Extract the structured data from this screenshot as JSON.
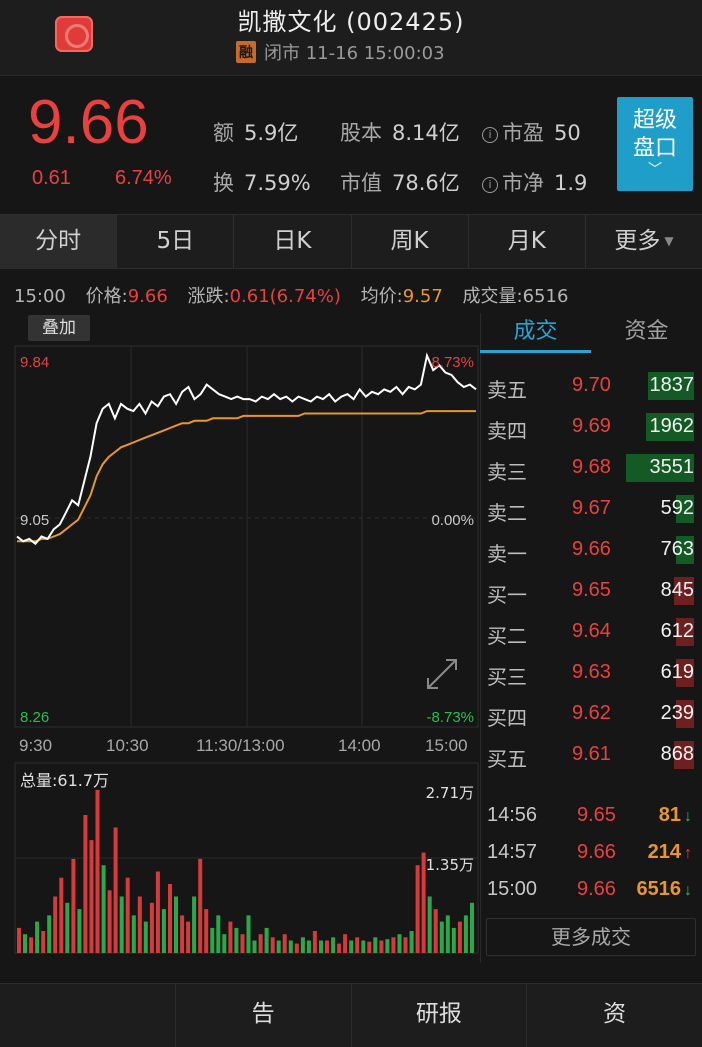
{
  "header": {
    "title": "凯撒文化 (002425)",
    "badge": "融",
    "status": "闭市 11-16 15:00:03"
  },
  "quote": {
    "price": "9.66",
    "change": "0.61",
    "change_pct": "6.74%",
    "stats": [
      {
        "label": "额",
        "value": "5.9亿"
      },
      {
        "label": "股本",
        "value": "8.14亿"
      },
      {
        "label": "市盈",
        "value": "50"
      },
      {
        "label": "换",
        "value": "7.59%"
      },
      {
        "label": "市值",
        "value": "78.6亿"
      },
      {
        "label": "市净",
        "value": "1.9"
      }
    ],
    "super_button": {
      "line1": "超级",
      "line2": "盘口",
      "chevron": "﹀"
    }
  },
  "tabs": [
    "分时",
    "5日",
    "日K",
    "周K",
    "月K",
    "更多"
  ],
  "infoline": {
    "time": "15:00",
    "price_label": "价格:",
    "price_value": "9.66",
    "change_label": "涨跌:",
    "change_value": "0.61(6.74%)",
    "avg_label": "均价:",
    "avg_value": "9.57",
    "volume_label": "成交量:",
    "volume_value": "6516"
  },
  "chart_overlay_button": "叠加",
  "chart_labels": {
    "y_top": "9.84",
    "y_mid": "9.05",
    "y_bottom": "8.26",
    "pct_top": "8.73%",
    "pct_mid": "0.00%",
    "pct_bottom": "-8.73%",
    "x_ticks": [
      "9:30",
      "10:30",
      "11:30/13:00",
      "14:00",
      "15:00"
    ],
    "volume_total": "总量:61.7万",
    "vol_top": "2.71万",
    "vol_mid": "1.35万"
  },
  "chart_data": {
    "type": "line",
    "title": "",
    "x_ticks": [
      "9:30",
      "10:30",
      "11:30/13:00",
      "14:00",
      "15:00"
    ],
    "ylim": [
      8.26,
      9.84
    ],
    "prev_close": 9.05,
    "series": [
      {
        "values": [
          9.05,
          9.03,
          9.04,
          9.02,
          9.05,
          9.04,
          9.08,
          9.1,
          9.15,
          9.2,
          9.18,
          9.28,
          9.38,
          9.52,
          9.58,
          9.6,
          9.54,
          9.6,
          9.58,
          9.57,
          9.6,
          9.56,
          9.61,
          9.59,
          9.63,
          9.64,
          9.6,
          9.65,
          9.67,
          9.62,
          9.64,
          9.68,
          9.66,
          9.64,
          9.63,
          9.62,
          9.63,
          9.62,
          9.62,
          9.61,
          9.63,
          9.62,
          9.64,
          9.62,
          9.63,
          9.61,
          9.63,
          9.62,
          9.61,
          9.63,
          9.62,
          9.64,
          9.61,
          9.63,
          9.64,
          9.62,
          9.66,
          9.63,
          9.65,
          9.64,
          9.66,
          9.65,
          9.67,
          9.64,
          9.67,
          9.66,
          9.68,
          9.8,
          9.74,
          9.76,
          9.73,
          9.72,
          9.69,
          9.67,
          9.68,
          9.66
        ]
      },
      {
        "values": [
          9.03,
          9.03,
          9.03,
          9.03,
          9.04,
          9.04,
          9.05,
          9.06,
          9.08,
          9.1,
          9.12,
          9.17,
          9.22,
          9.3,
          9.35,
          9.38,
          9.4,
          9.42,
          9.43,
          9.44,
          9.45,
          9.46,
          9.47,
          9.48,
          9.49,
          9.5,
          9.51,
          9.52,
          9.52,
          9.53,
          9.53,
          9.53,
          9.54,
          9.54,
          9.54,
          9.54,
          9.54,
          9.55,
          9.55,
          9.55,
          9.55,
          9.55,
          9.55,
          9.55,
          9.55,
          9.55,
          9.55,
          9.56,
          9.56,
          9.56,
          9.56,
          9.56,
          9.56,
          9.56,
          9.56,
          9.56,
          9.56,
          9.56,
          9.56,
          9.56,
          9.56,
          9.56,
          9.56,
          9.56,
          9.56,
          9.56,
          9.56,
          9.57,
          9.57,
          9.57,
          9.57,
          9.57,
          9.57,
          9.57,
          9.57,
          9.57
        ]
      }
    ],
    "volume": {
      "ylim": [
        0,
        27100
      ],
      "values": [
        4000,
        3000,
        2500,
        5000,
        3500,
        6000,
        9000,
        12000,
        8000,
        15000,
        7000,
        22000,
        18000,
        26000,
        14000,
        10000,
        20000,
        9000,
        12000,
        6000,
        9000,
        5000,
        8000,
        13000,
        7000,
        11000,
        9000,
        6000,
        5000,
        9000,
        15000,
        7000,
        4000,
        6000,
        3000,
        5000,
        4000,
        3000,
        6000,
        2000,
        3000,
        4000,
        2500,
        2000,
        3000,
        2000,
        1500,
        2500,
        2000,
        3500,
        2000,
        2000,
        2500,
        1500,
        3000,
        2000,
        2500,
        2000,
        1800,
        2500,
        2000,
        2200,
        2500,
        3000,
        2500,
        3500,
        14000,
        16000,
        9000,
        7000,
        5000,
        6000,
        4000,
        5000,
        6000,
        8000
      ],
      "up": [
        1,
        0,
        1,
        0,
        1,
        0,
        1,
        1,
        0,
        1,
        0,
        1,
        1,
        1,
        0,
        1,
        1,
        0,
        1,
        0,
        1,
        0,
        1,
        1,
        0,
        1,
        0,
        1,
        1,
        0,
        1,
        1,
        0,
        0,
        0,
        1,
        0,
        1,
        0,
        0,
        1,
        0,
        1,
        0,
        1,
        0,
        1,
        0,
        0,
        1,
        0,
        1,
        0,
        1,
        1,
        0,
        1,
        0,
        1,
        0,
        1,
        0,
        1,
        0,
        1,
        0,
        1,
        1,
        0,
        1,
        0,
        0,
        0,
        1,
        0,
        0
      ]
    }
  },
  "right_tabs": [
    "成交",
    "资金"
  ],
  "order_book": [
    {
      "label": "卖五",
      "price": "9.70",
      "vol": "1837",
      "side": "sell",
      "fill": 0.23
    },
    {
      "label": "卖四",
      "price": "9.69",
      "vol": "1962",
      "side": "sell",
      "fill": 0.24
    },
    {
      "label": "卖三",
      "price": "9.68",
      "vol": "3551",
      "side": "sell",
      "fill": 0.34
    },
    {
      "label": "卖二",
      "price": "9.67",
      "vol": "592",
      "side": "sell",
      "fill": 0.07
    },
    {
      "label": "卖一",
      "price": "9.66",
      "vol": "763",
      "side": "sell",
      "fill": 0.09
    },
    {
      "label": "买一",
      "price": "9.65",
      "vol": "845",
      "side": "buy",
      "fill": 0.1
    },
    {
      "label": "买二",
      "price": "9.64",
      "vol": "612",
      "side": "buy",
      "fill": 0.07
    },
    {
      "label": "买三",
      "price": "9.63",
      "vol": "619",
      "side": "buy",
      "fill": 0.07
    },
    {
      "label": "买四",
      "price": "9.62",
      "vol": "239",
      "side": "buy",
      "fill": 0.03
    },
    {
      "label": "买五",
      "price": "9.61",
      "vol": "868",
      "side": "buy",
      "fill": 0.1
    }
  ],
  "trades": [
    {
      "time": "14:56",
      "price": "9.65",
      "vol": "81",
      "dir": "↓",
      "dir_color": "#2cbe4e"
    },
    {
      "time": "14:57",
      "price": "9.66",
      "vol": "214",
      "dir": "↑",
      "dir_color": "#e8413f"
    },
    {
      "time": "15:00",
      "price": "9.66",
      "vol": "6516",
      "dir": "↓",
      "dir_color": "#2cbe4e"
    }
  ],
  "more_trades_label": "更多成交",
  "bottom_bar": [
    "",
    "告",
    "研报",
    "资"
  ],
  "colors": {
    "up": "#e8413f",
    "down": "#2cbe4e",
    "avg": "#e8962d",
    "accent": "#25a4d6",
    "price_line": "#ffffff"
  }
}
